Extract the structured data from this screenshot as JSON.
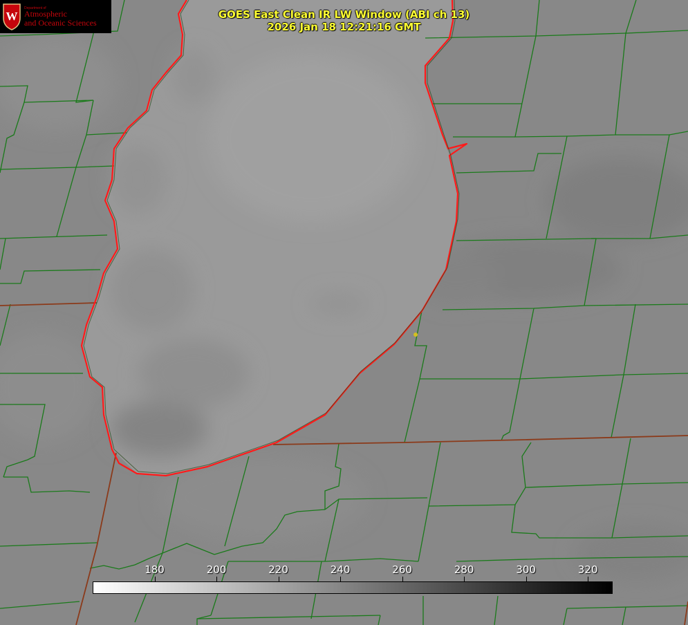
{
  "title": {
    "line1": "GOES East Clean IR LW Window (ABI ch 13)",
    "line2": "2026 Jan 18 12:21:16 GMT"
  },
  "logo": {
    "crest_letter": "W",
    "dept": "Department of",
    "line1": "Atmospheric",
    "line2": "and Oceanic Sciences",
    "brand_color": "#c5050c"
  },
  "colorbar": {
    "range": [
      160,
      328
    ],
    "ticks": [
      "180",
      "200",
      "220",
      "240",
      "260",
      "280",
      "300",
      "320"
    ],
    "tick_values": [
      180,
      200,
      220,
      240,
      260,
      280,
      300,
      320
    ],
    "color_start": "#ffffff",
    "color_end": "#000000"
  },
  "colors": {
    "county_lines": "#1a7a1a",
    "shoreline": "#ff1a1a",
    "state_lines": "#8b3a1a",
    "marker": "#d4c020",
    "land": "#888888",
    "lake": "#999999"
  }
}
